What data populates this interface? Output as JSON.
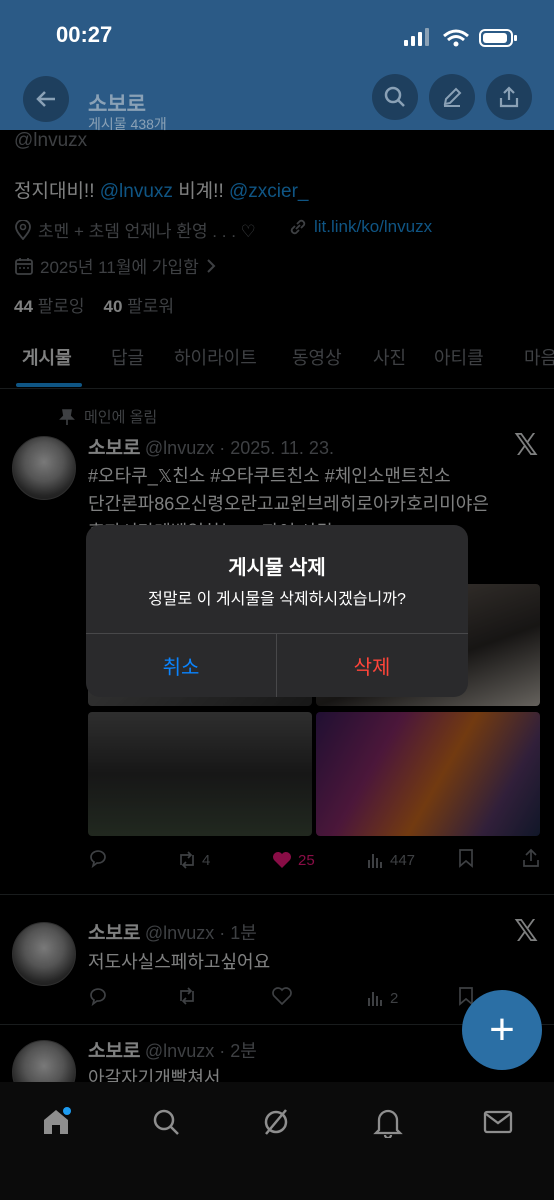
{
  "status": {
    "time": "00:27"
  },
  "header": {
    "name": "소보로",
    "post_count": "게시물 438개"
  },
  "profile": {
    "handle": "@lnvuzx",
    "bio_prefix": "정지대비!!",
    "bio_mention1": "@lnvuxz",
    "bio_mid": "비계!!",
    "bio_mention2": "@zxcier_",
    "location": "초멘 + 초뎀 언제나 환영 . . . ♡",
    "website": "lit.link/ko/lnvuzx",
    "joined": "2025년 11월에 가입함",
    "following_count": "44",
    "following_label": "팔로잉",
    "followers_count": "40",
    "followers_label": "팔로워"
  },
  "tabs": [
    {
      "label": "게시물"
    },
    {
      "label": "답글"
    },
    {
      "label": "하이라이트"
    },
    {
      "label": "동영상"
    },
    {
      "label": "사진"
    },
    {
      "label": "아티클"
    },
    {
      "label": "마음"
    }
  ],
  "pinned": {
    "label": "메인에 올림",
    "name": "소보로",
    "meta": "@lnvuzx · 2025. 11. 23.",
    "tags": "#오타쿠_𝕏친소 #오타쿠트친소 #체인소맨트친소",
    "line2": "단간론파86오신령오란고교윈브레히로아카호리미야은",
    "line3": "혼자서만레벨업하는 ... 파여 사담",
    "replies": "",
    "reposts": "4",
    "likes": "25",
    "views": "447"
  },
  "post2": {
    "name": "소보로",
    "meta": "@lnvuzx · 1분",
    "text": "저도사실스페하고싶어요",
    "reposts": "",
    "likes": "",
    "views": "2"
  },
  "post3": {
    "name": "소보로",
    "meta": "@lnvuzx · 2분",
    "text": "아갈자기개빡쳐서"
  },
  "dialog": {
    "title": "게시물 삭제",
    "message": "정말로 이 게시물을 삭제하시겠습니까?",
    "cancel": "취소",
    "confirm": "삭제"
  },
  "colors": {
    "accent": "#1d9bf0",
    "like": "#f91880",
    "destructive": "#ff453a",
    "cancel": "#0a84ff"
  }
}
